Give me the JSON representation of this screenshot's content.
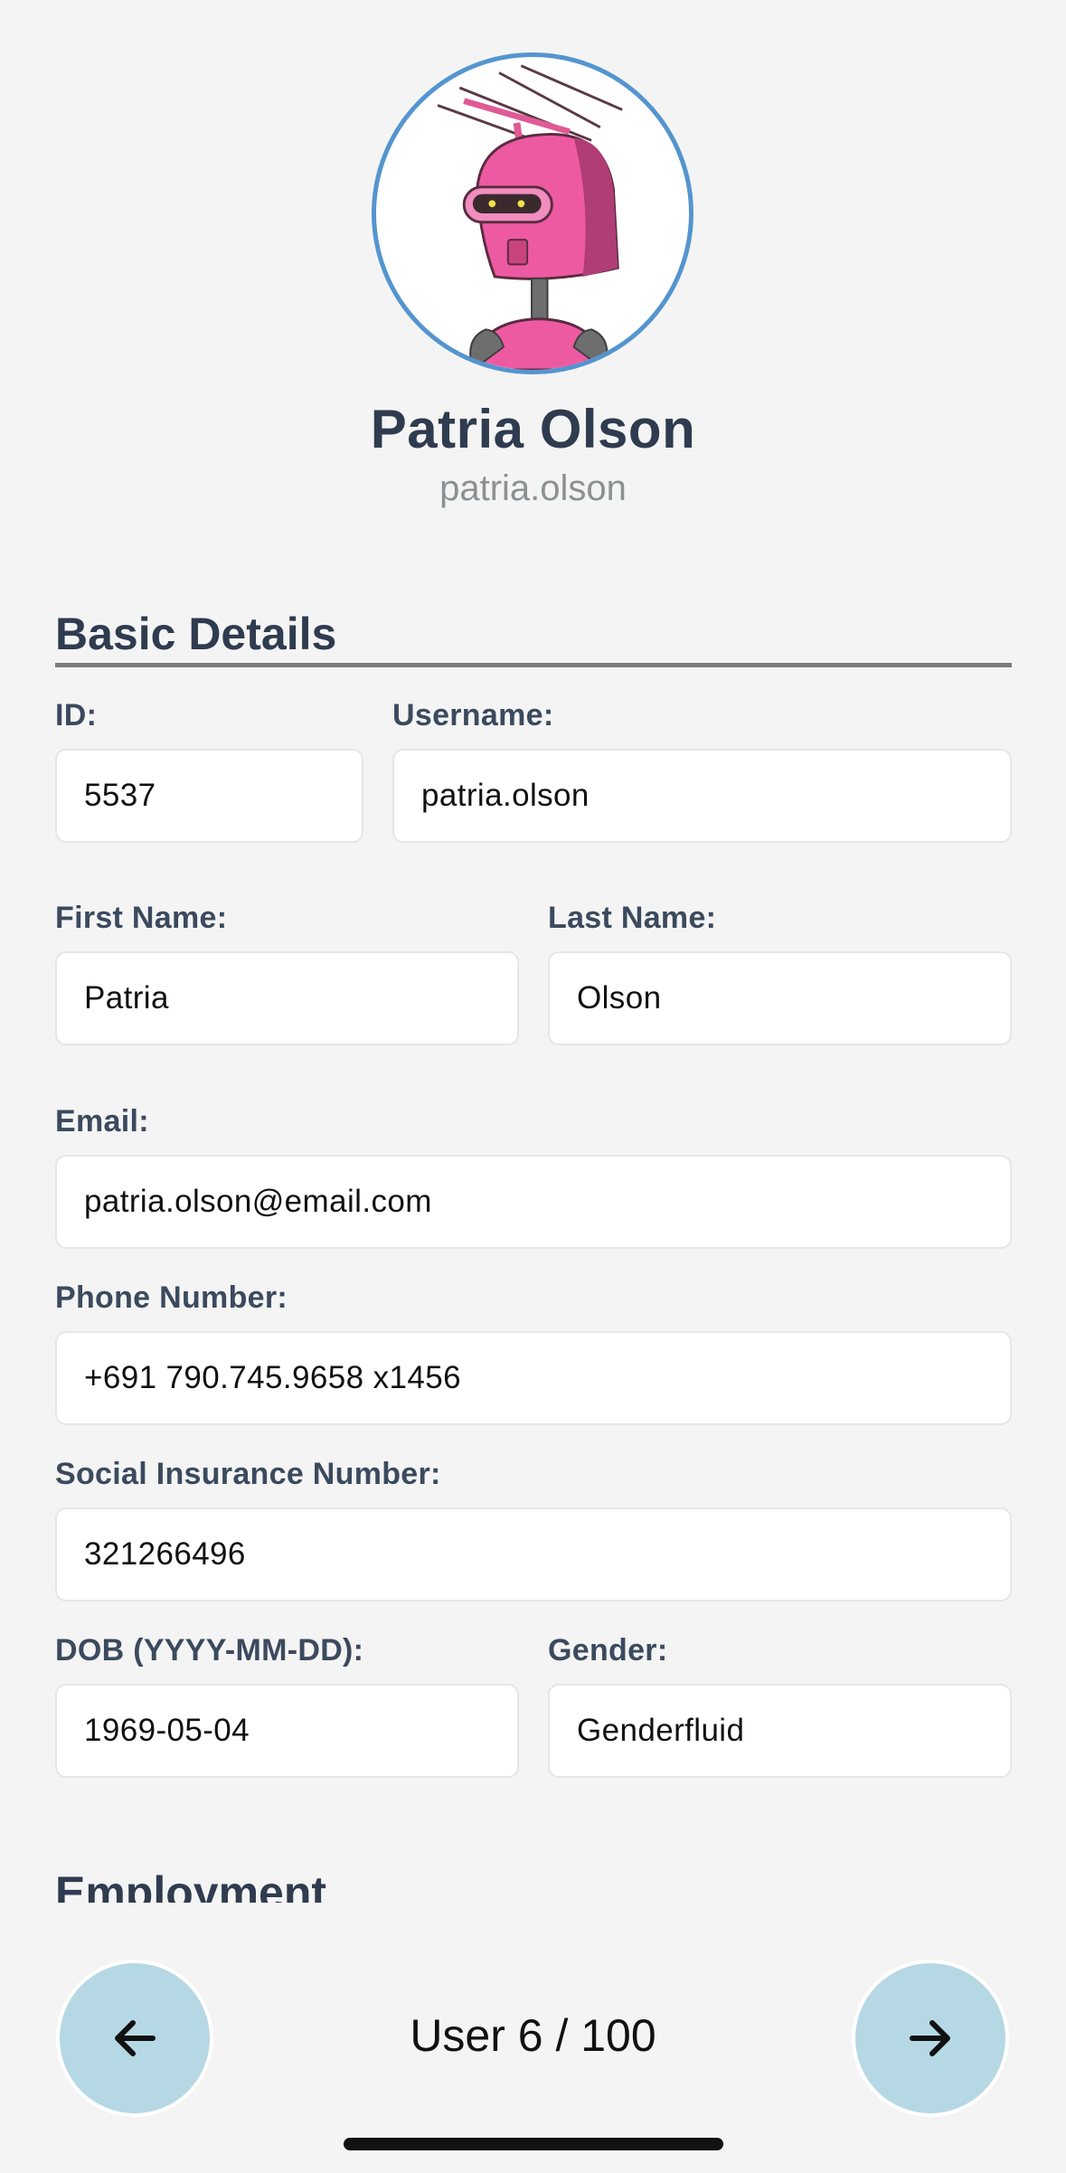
{
  "profile": {
    "name": "Patria Olson",
    "username": "patria.olson",
    "avatar_icon": "pink-robot-avatar",
    "avatar_border_color": "#5495cf"
  },
  "sections": {
    "basic_title": "Basic Details",
    "employment_title": "Employment"
  },
  "fields": {
    "id": {
      "label": "ID:",
      "value": "5537"
    },
    "username": {
      "label": "Username:",
      "value": "patria.olson"
    },
    "first_name": {
      "label": "First Name:",
      "value": "Patria"
    },
    "last_name": {
      "label": "Last Name:",
      "value": "Olson"
    },
    "email": {
      "label": "Email:",
      "value": "patria.olson@email.com"
    },
    "phone": {
      "label": "Phone Number:",
      "value": "+691 790.745.9658 x1456"
    },
    "sin": {
      "label": "Social Insurance Number:",
      "value": "321266496"
    },
    "dob": {
      "label": "DOB (YYYY-MM-DD):",
      "value": "1969-05-04"
    },
    "gender": {
      "label": "Gender:",
      "value": "Genderfluid"
    }
  },
  "pager": {
    "text": "User 6 / 100",
    "prev_icon": "arrow-left-icon",
    "next_icon": "arrow-right-icon",
    "button_color": "#b5d8e4"
  }
}
